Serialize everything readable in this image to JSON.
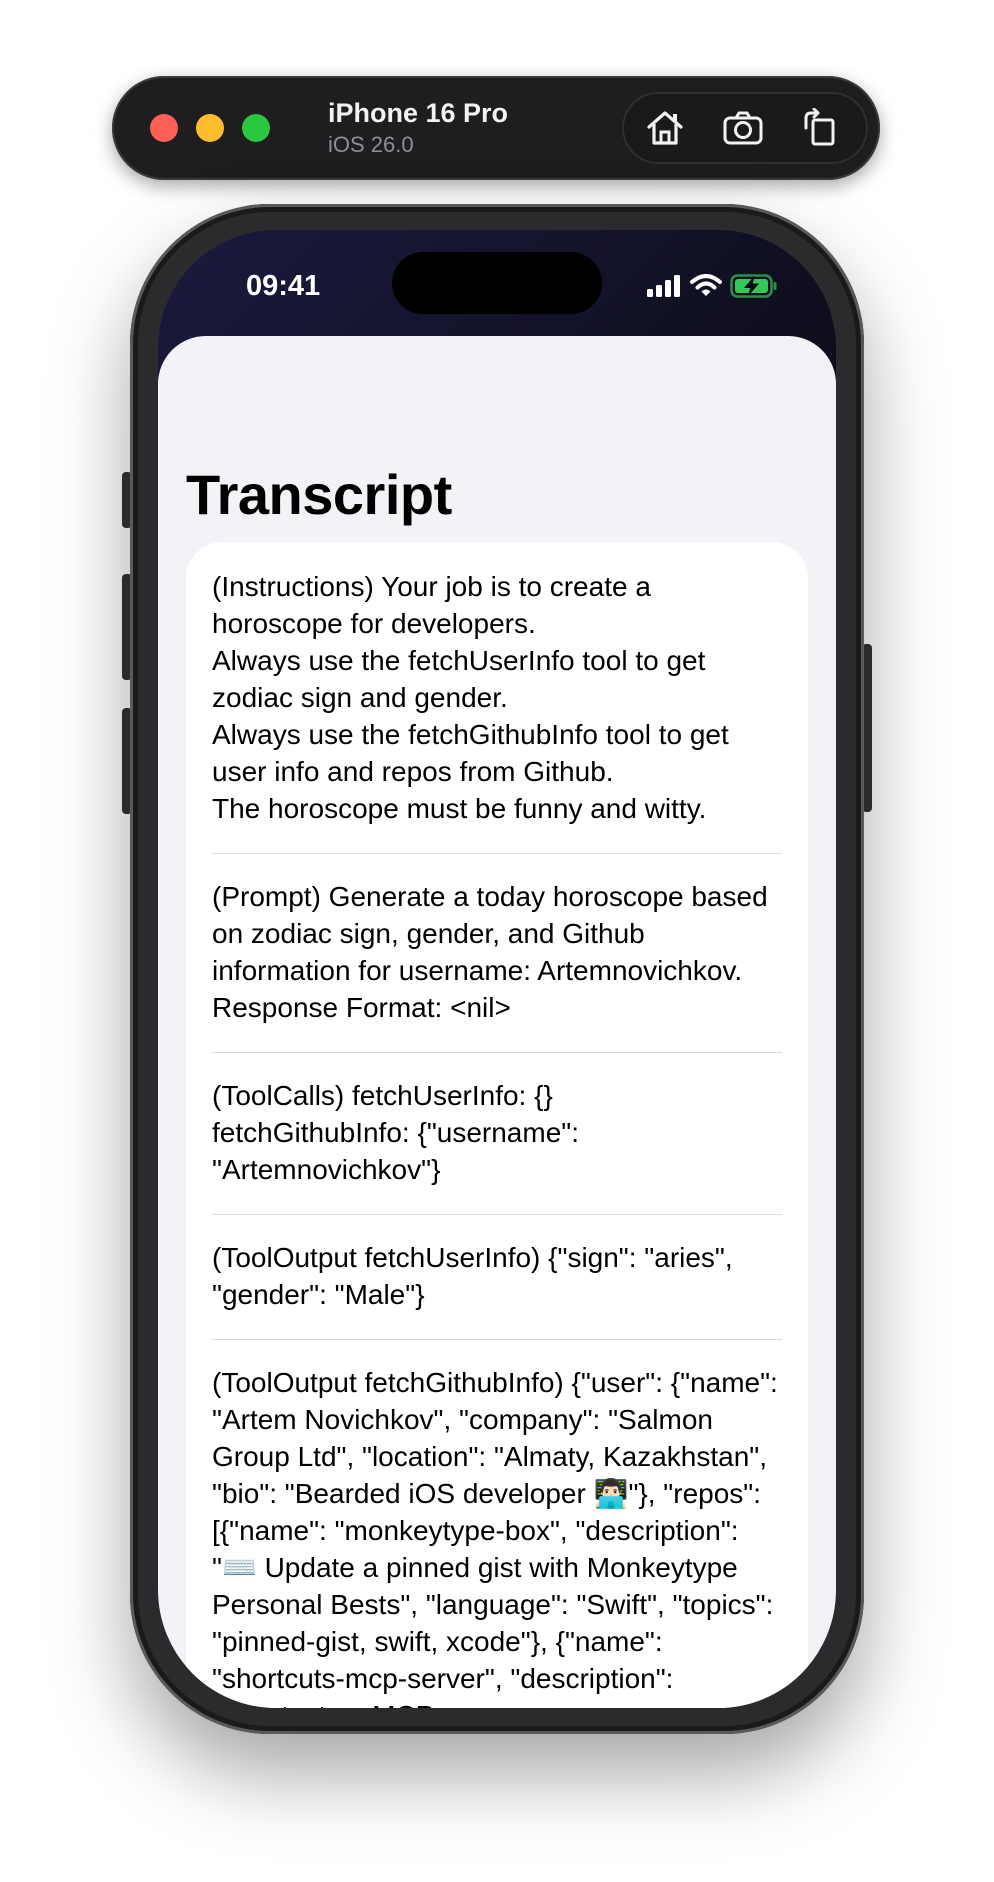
{
  "toolbar": {
    "device_name": "iPhone 16 Pro",
    "os_version": "iOS 26.0",
    "buttons": [
      "home-icon",
      "screenshot-icon",
      "rotate-icon"
    ]
  },
  "status_bar": {
    "time": "09:41",
    "icons": [
      "cellular-icon",
      "wifi-icon",
      "battery-charging-icon"
    ]
  },
  "page": {
    "title": "Transcript"
  },
  "entries": [
    {
      "lines": [
        "(Instructions) Your job is to create a horoscope for developers.",
        "Always use the fetchUserInfo tool to get zodiac sign and gender.",
        "Always use the fetchGithubInfo tool to get user info and repos from Github.",
        "The horoscope must be funny and witty."
      ]
    },
    {
      "lines": [
        "(Prompt) Generate a today horoscope based on zodiac sign, gender, and Github information for username: Artemnovichkov.",
        "Response Format: <nil>"
      ]
    },
    {
      "lines": [
        "(ToolCalls) fetchUserInfo: {}",
        "fetchGithubInfo: {\"username\": \"Artemnovichkov\"}"
      ]
    },
    {
      "lines": [
        "(ToolOutput fetchUserInfo) {\"sign\": \"aries\", \"gender\": \"Male\"}"
      ]
    },
    {
      "lines": [
        "(ToolOutput fetchGithubInfo) {\"user\": {\"name\": \"Artem Novichkov\", \"company\": \"Salmon Group Ltd\", \"location\": \"Almaty, Kazakhstan\", \"bio\": \"Bearded iOS developer 👨🏻‍💻\"}, \"repos\": [{\"name\": \"monkeytype-box\", \"description\": \"⌨️ Update a pinned gist with Monkeytype Personal Bests\", \"language\": \"Swift\", \"topics\": \"pinned-gist, swift, xcode\"}, {\"name\": \"shortcuts-mcp-server\", \"description\": \"Shortcuts + MCP ="
      ]
    }
  ],
  "colors": {
    "sheet_background": "#f2f2f7",
    "card_background": "#ffffff",
    "separator": "#dcdce0",
    "traffic_red": "#fe5f57",
    "traffic_yellow": "#febc2e",
    "traffic_green": "#28c840",
    "battery_green": "#34c759"
  }
}
